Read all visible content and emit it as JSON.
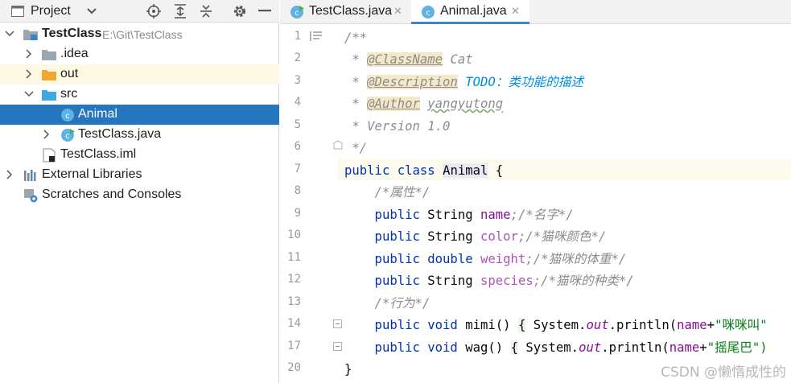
{
  "project_panel": {
    "title": "Project",
    "tree": [
      {
        "label": "TestClass",
        "path": "E:\\Git\\TestClass"
      },
      {
        "label": ".idea"
      },
      {
        "label": "out"
      },
      {
        "label": "src"
      },
      {
        "label": "Animal"
      },
      {
        "label": "TestClass.java"
      },
      {
        "label": "TestClass.iml"
      },
      {
        "label": "External Libraries"
      },
      {
        "label": "Scratches and Consoles"
      }
    ]
  },
  "editor": {
    "tabs": [
      {
        "label": "TestClass.java",
        "active": false
      },
      {
        "label": "Animal.java",
        "active": true
      }
    ],
    "line_numbers": [
      "1",
      "2",
      "3",
      "4",
      "5",
      "6",
      "7",
      "8",
      "9",
      "10",
      "11",
      "12",
      "13",
      "14",
      "17",
      "20"
    ],
    "code": {
      "l1": "/**",
      "l2_star": " * ",
      "l2_tag": "@ClassName",
      "l2_val": " Cat",
      "l3_star": " * ",
      "l3_tag": "@Description",
      "l3_val": " TODO：类功能的描述",
      "l4_star": " * ",
      "l4_tag": "@Author",
      "l4_val": "yangyutong",
      "l5": " * Version 1.0",
      "l6": " */",
      "l7_kw": "public class ",
      "l7_cls": "Animal",
      "l7_end": " {",
      "l8": "    /*属性*/",
      "l9_kw": "    public ",
      "l9_type": "String ",
      "l9_name": "name",
      "l9_cm": ";/*名字*/",
      "l10_kw": "    public ",
      "l10_type": "String ",
      "l10_name": "color",
      "l10_cm": ";/*猫咪颜色*/",
      "l11_kw": "    public double ",
      "l11_name": "weight",
      "l11_cm": ";/*猫咪的体重*/",
      "l12_kw": "    public ",
      "l12_type": "String ",
      "l12_name": "species",
      "l12_cm": ";/*猫咪的种类*/",
      "l13": "    /*行为*/",
      "l14_kw": "    public void ",
      "l14_name": "mimi() ",
      "l14_brace": "{",
      "l14_sys": " System.",
      "l14_out": "out",
      "l14_print": ".println(",
      "l14_field": "name",
      "l14_plus": "+",
      "l14_str": "\"咪咪叫\"",
      "l17_kw": "    public void ",
      "l17_name": "wag() ",
      "l17_brace": "{",
      "l17_sys": " System.",
      "l17_out": "out",
      "l17_print": ".println(",
      "l17_field": "name",
      "l17_plus": "+",
      "l17_str": "\"摇尾巴\")",
      "l20": "}"
    }
  },
  "watermark": "CSDN @懒惰成性的"
}
